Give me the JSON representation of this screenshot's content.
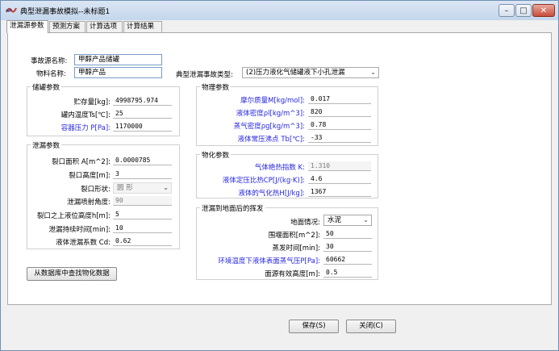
{
  "window": {
    "title": "典型泄漏事故模拟--未标题1",
    "minimize": "–",
    "maximize": "□",
    "close": "✕"
  },
  "tabs": [
    {
      "label": "泄漏源参数",
      "active": true
    },
    {
      "label": "预测方案",
      "active": false
    },
    {
      "label": "计算选项",
      "active": false
    },
    {
      "label": "计算结果",
      "active": false
    }
  ],
  "source": {
    "name_label": "事故源名称:",
    "name_value": "甲醇产品储罐",
    "material_label": "物料名称:",
    "material_value": "甲醇产品",
    "type_label": "典型泄漏事故类型:",
    "type_value": "(2)压力液化气储罐液下小孔泄漏"
  },
  "storage": {
    "title": "储罐参数",
    "volume_label": "贮存量[kg]:",
    "volume_value": "4998795.974",
    "temp_label": "罐内温度Ts[℃]:",
    "temp_value": "25",
    "pressure_label": "容器压力 P[Pa]:",
    "pressure_value": "1170000"
  },
  "leak": {
    "title": "泄漏参数",
    "area_label": "裂口面积 A[m^2]:",
    "area_value": "0.0000785",
    "height_label": "裂口高度[m]:",
    "height_value": "3",
    "shape_label": "裂口形状:",
    "shape_value": "圆 形",
    "angle_label": "泄漏喷射角度:",
    "angle_value": "90",
    "liquid_height_label": "裂口之上液位高度h[m]:",
    "liquid_height_value": "5",
    "duration_label": "泄漏持续时间[min]:",
    "duration_value": "10",
    "coef_label": "液体泄漏系数  Cd:",
    "coef_value": "0.62"
  },
  "physical": {
    "title": "物理参数",
    "molar_label": "摩尔质量M[kg/mol]:",
    "molar_value": "0.017",
    "liq_density_label": "液体密度ρl[kg/m^3]:",
    "liq_density_value": "820",
    "vap_density_label": "蒸气密度ρg[kg/m^3]:",
    "vap_density_value": "0.78",
    "boiling_label": "液体常压沸点 Tb[℃]:",
    "boiling_value": "-33"
  },
  "chemical": {
    "title": "物化参数",
    "adiabatic_label": "气体绝热指数  K:",
    "adiabatic_value": "1.310",
    "heat_cap_label": "液体定压比热CP[J/(kg·K)]:",
    "heat_cap_value": "4.6",
    "vaporization_label": "液体的气化热H[J/kg]:",
    "vaporization_value": "1367"
  },
  "evap": {
    "title": "泄漏到地面后的挥发",
    "ground_label": "地面情况:",
    "ground_value": "水泥",
    "dike_label": "围堰面积[m^2]:",
    "dike_value": "50",
    "evap_time_label": "蒸发时间[min]:",
    "evap_time_value": "30",
    "vapor_pressure_label": "环境温度下液体表面蒸气压P[Pa]:",
    "vapor_pressure_value": "60662",
    "surface_height_label": "面源有效高度[m]:",
    "surface_height_value": "0.5"
  },
  "buttons": {
    "lookup": "从数据库中查找物化数据",
    "save": "保存(S)",
    "close": "关闭(C)"
  },
  "colors": {
    "accent_label": "#2424e0",
    "title_bar": "#c4d6ec"
  }
}
